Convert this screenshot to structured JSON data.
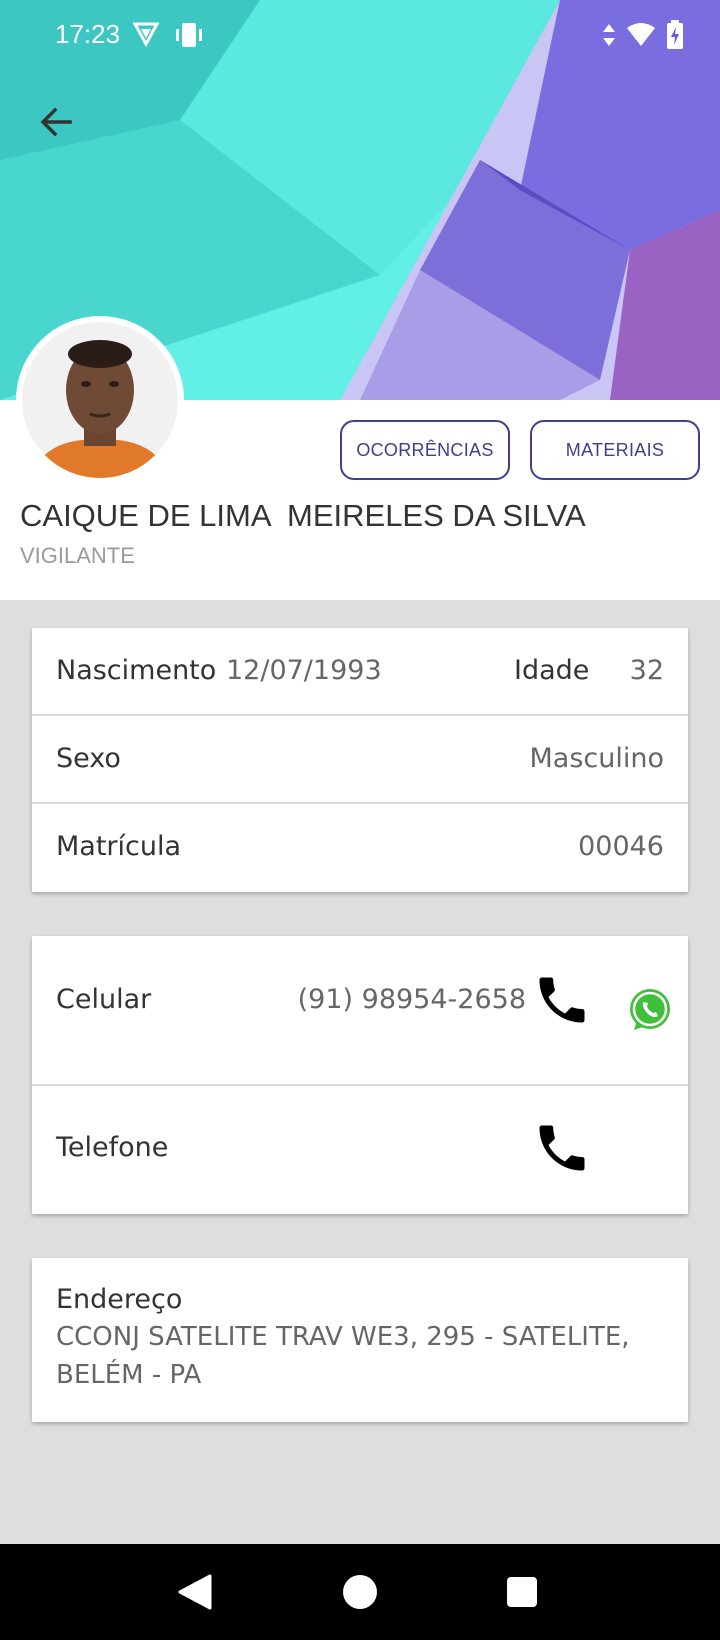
{
  "status_bar": {
    "time": "17:23",
    "icons_left": [
      "vpn-shield-icon",
      "phone-vibrate-icon"
    ],
    "icons_right": [
      "data-arrows-icon",
      "wifi-icon",
      "battery-charging-icon"
    ]
  },
  "header": {
    "back_icon": "arrow-back-icon"
  },
  "profile": {
    "name": "CAIQUE DE LIMA  MEIRELES DA SILVA",
    "role": "VIGILANTE",
    "buttons": {
      "ocorrencias": "OCORRÊNCIAS",
      "materiais": "MATERIAIS"
    }
  },
  "info": {
    "nascimento_label": "Nascimento",
    "nascimento_value": "12/07/1993",
    "idade_label": "Idade",
    "idade_value": "32",
    "sexo_label": "Sexo",
    "sexo_value": "Masculino",
    "matricula_label": "Matrícula",
    "matricula_value": "00046"
  },
  "contact": {
    "celular_label": "Celular",
    "celular_value": "(91) 98954-2658",
    "telefone_label": "Telefone",
    "call_icon": "phone-icon",
    "whatsapp_icon": "whatsapp-icon"
  },
  "address": {
    "label": "Endereço",
    "line1": "CCONJ SATELITE TRAV WE3, 295 - SATELITE,",
    "line2": "BELÉM - PA"
  },
  "nav": {
    "back": "nav-back-icon",
    "home": "nav-home-icon",
    "recents": "nav-recents-icon"
  },
  "colors": {
    "accent": "#3d3f8f",
    "background": "#dedede"
  }
}
